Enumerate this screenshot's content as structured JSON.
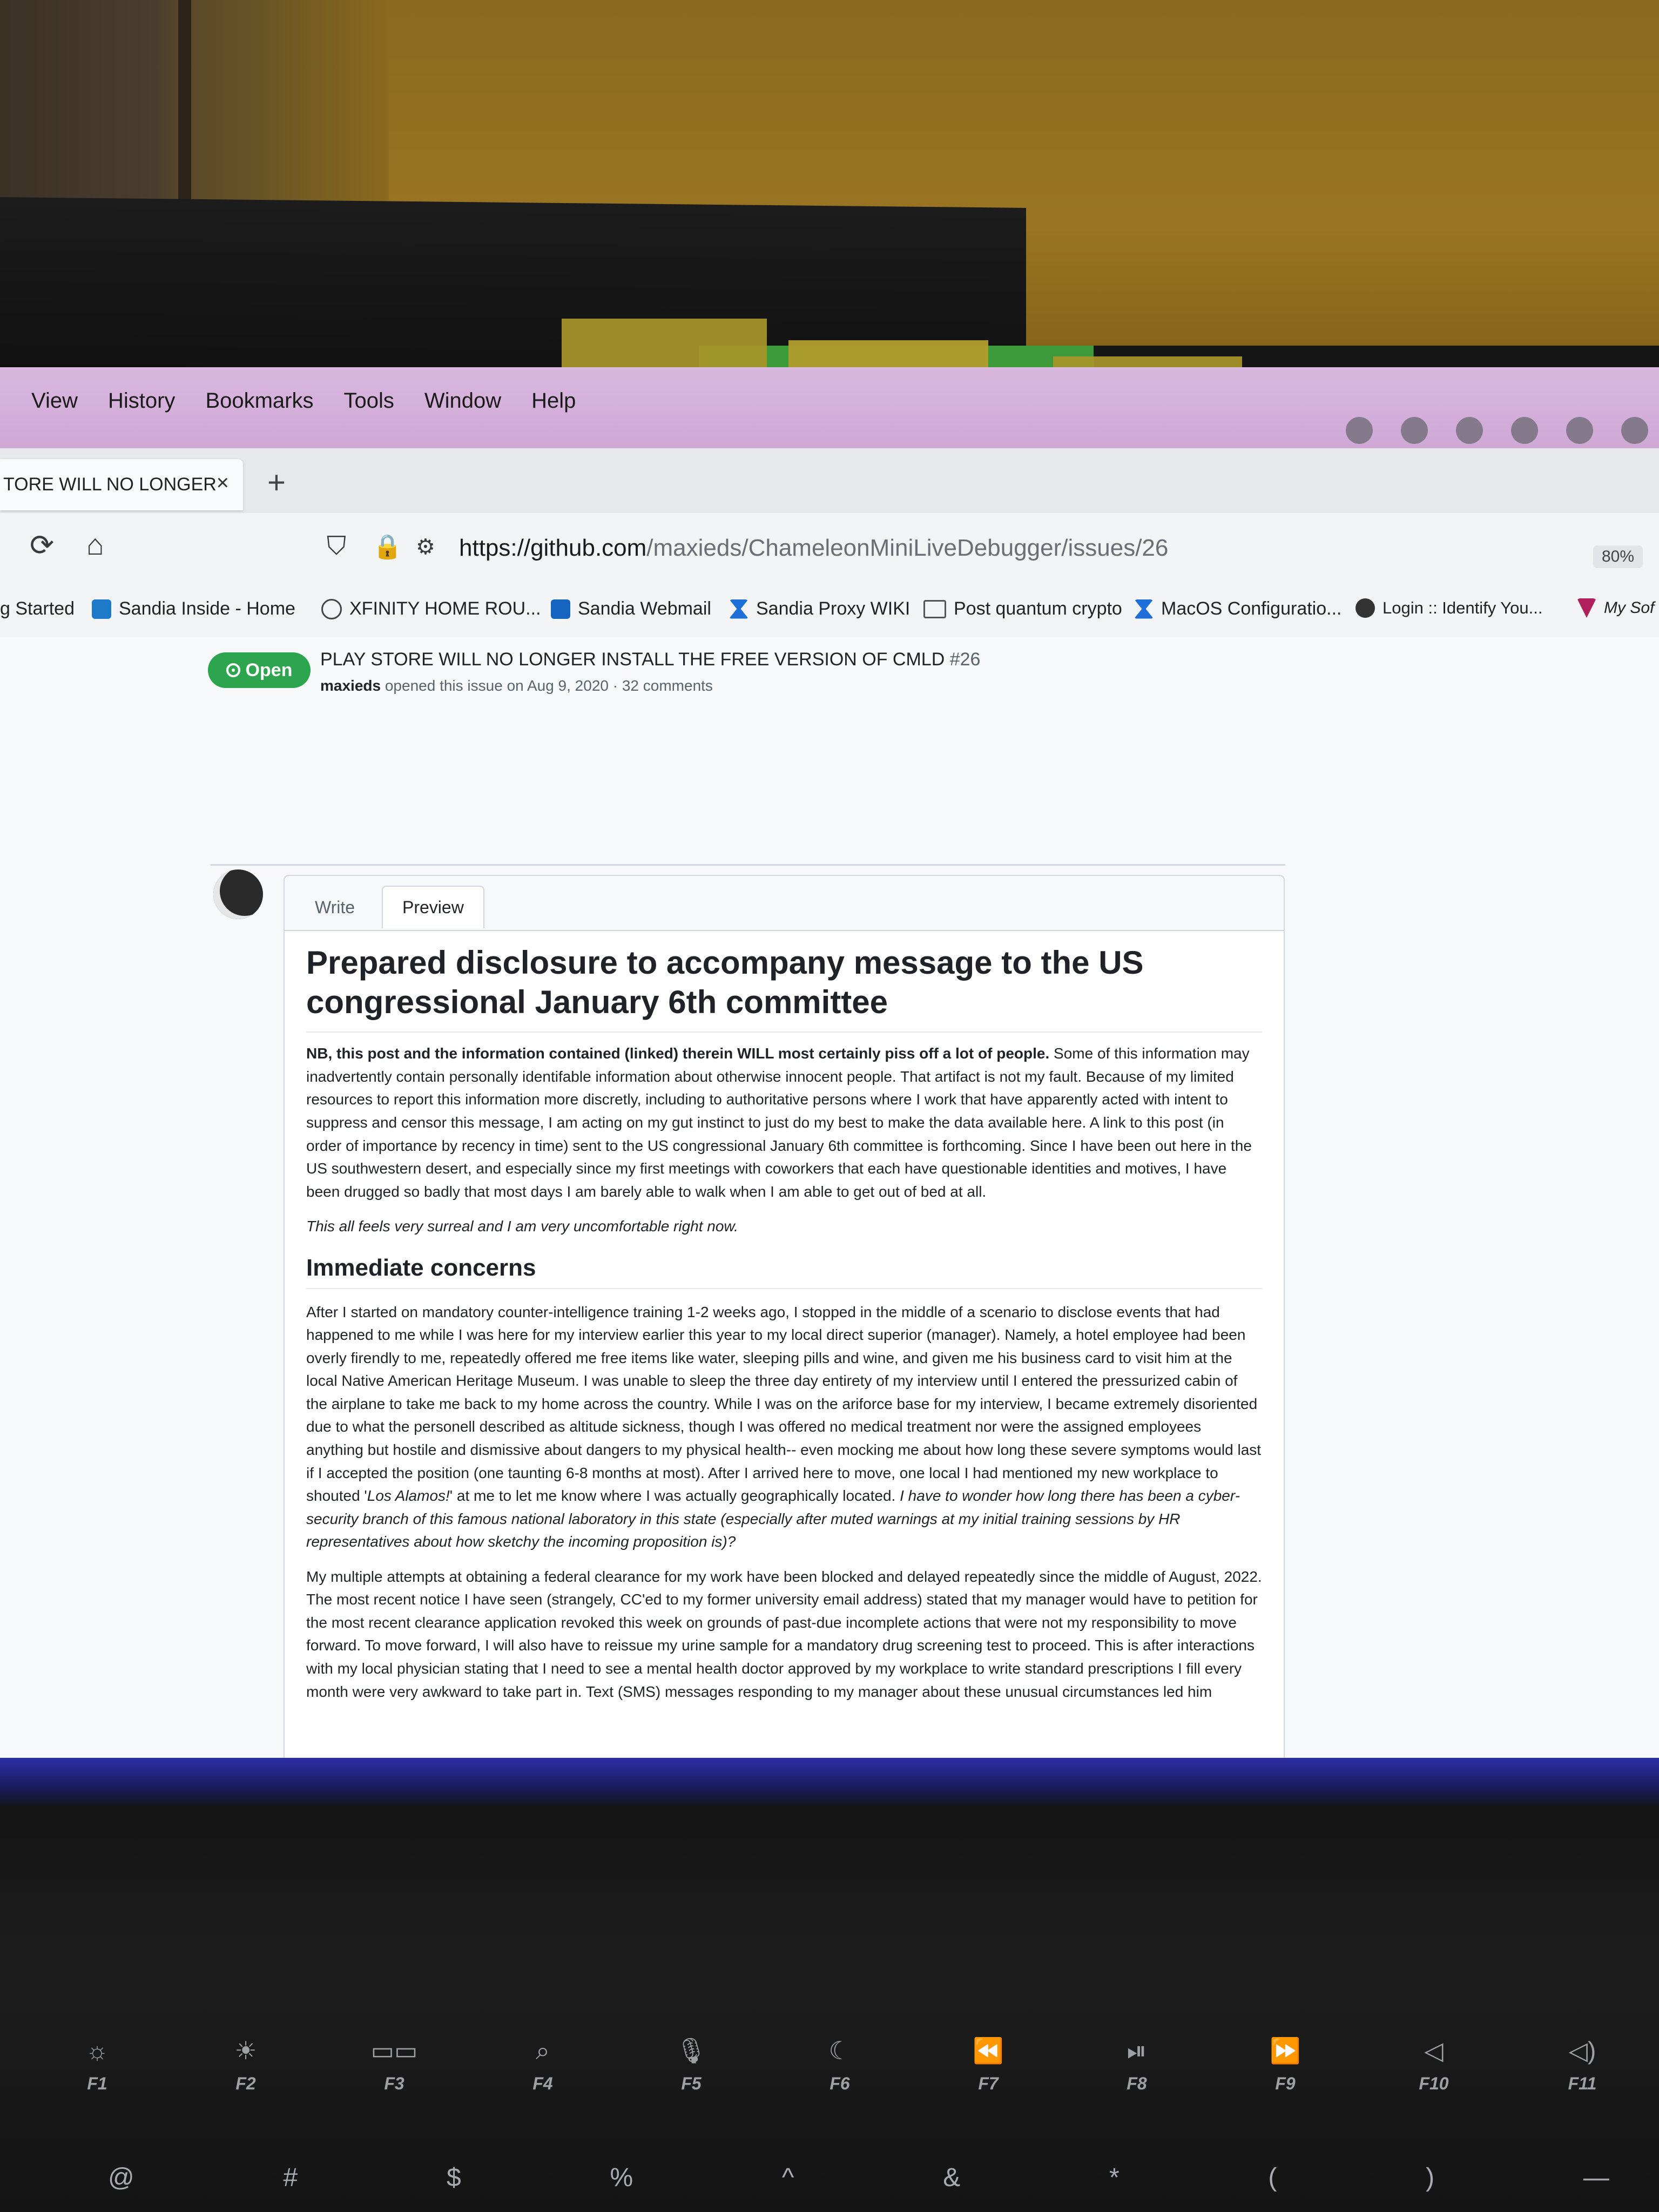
{
  "menubar": {
    "items": [
      "View",
      "History",
      "Bookmarks",
      "Tools",
      "Window",
      "Help"
    ]
  },
  "tab": {
    "title": "TORE WILL NO LONGER",
    "close": "×",
    "new_tab": "+"
  },
  "nav": {
    "url_host": "https://github.com",
    "url_path": "/maxieds/ChameleonMiniLiveDebugger/issues/26",
    "zoom": "80%"
  },
  "bookmarks": [
    {
      "label": "g Started"
    },
    {
      "label": "Sandia Inside - Home"
    },
    {
      "label": "XFINITY HOME ROU..."
    },
    {
      "label": "Sandia Webmail"
    },
    {
      "label": "Sandia Proxy WIKI"
    },
    {
      "label": "Post quantum crypto"
    },
    {
      "label": "MacOS Configuratio..."
    },
    {
      "label": "Login :: Identify You..."
    },
    {
      "label": "My Sof"
    }
  ],
  "issue": {
    "state": "Open",
    "title": "PLAY STORE WILL NO LONGER INSTALL THE FREE VERSION OF CMLD",
    "number": "#26",
    "author": "maxieds",
    "meta": "opened this issue on Aug 9, 2020 · 32 comments"
  },
  "editor": {
    "tab_write": "Write",
    "tab_preview": "Preview",
    "heading": "Prepared disclosure to accompany message to the US congressional January 6th committee",
    "p1_bold": "NB, this post and the information contained (linked) therein WILL most certainly piss off a lot of people.",
    "p1_rest": " Some of this information may inadvertently contain personally identifable information about otherwise innocent people. That artifact is not my fault. Because of my limited resources to report this information more discretly, including to authoritative persons where I work that have apparently acted with intent to suppress and censor this message, I am acting on my gut instinct to just do my best to make the data available here. A link to this post (in order of importance by recency in time) sent to the US congressional January 6th committee is forthcoming. Since I have been out here in the US southwestern desert, and especially since my first meetings with coworkers that each have questionable identities and motives, I have been drugged so badly that most days I am barely able to walk when I am able to get out of bed at all.",
    "p2": "This all feels very surreal and I am very uncomfortable right now.",
    "h2": "Immediate concerns",
    "p3_a": "After I started on mandatory counter-intelligence training 1-2 weeks ago, I stopped in the middle of a scenario to disclose events that had happened to me while I was here for my interview earlier this year to my local direct superior (manager). Namely, a hotel employee had been overly firendly to me, repeatedly offered me free items like water, sleeping pills and wine, and given me his business card to visit him at the local Native American Heritage Museum. I was unable to sleep the three day entirety of my interview until I entered the pressurized cabin of the airplane to take me back to my home across the country. While I was on the ariforce base for my interview, I became extremely disoriented due to what the personell described as altitude sickness, though I was offered no medical treatment nor were the assigned employees anything but hostile and dismissive about dangers to my physical health-- even mocking me about how long these severe symptoms would last if I accepted the position (one taunting 6-8 months at most). After I arrived here to move, one local I had mentioned my new workplace to shouted '",
    "p3_quote": "Los Alamos!",
    "p3_b": "' at me to let me know where I was actually geographically located. ",
    "p3_italic": "I have to wonder how long there has been a cyber-security branch of this famous national laboratory in this state (especially after muted warnings at my initial training sessions by HR representatives about how sketchy the incoming proposition is)?",
    "p4": "My multiple attempts at obtaining a federal clearance for my work have been blocked and delayed repeatedly since the middle of August, 2022. The most recent notice I have seen (strangely, CC'ed to my former university email address) stated that my manager would have to petition for the most recent clearance application revoked this week on grounds of past-due incomplete actions that were not my responsibility to move forward. To move forward, I will also have to reissue my urine sample for a mandatory drug screening test to proceed. This is after interactions with my local physician stating that I need to see a mental health doctor approved by my workplace to write standard prescriptions I fill every month were very awkward to take part in. Text (SMS) messages responding to my manager about these unusual circumstances led him"
  },
  "keyboard": {
    "fkeys": [
      {
        "icon": "brightness-down-icon",
        "glyph": "☼",
        "label": "F1"
      },
      {
        "icon": "brightness-up-icon",
        "glyph": "☀",
        "label": "F2"
      },
      {
        "icon": "mission-control-icon",
        "glyph": "▭▭",
        "label": "F3"
      },
      {
        "icon": "search-icon",
        "glyph": "⌕",
        "label": "F4"
      },
      {
        "icon": "microphone-icon",
        "glyph": "🎙",
        "label": "F5"
      },
      {
        "icon": "moon-icon",
        "glyph": "☾",
        "label": "F6"
      },
      {
        "icon": "rewind-icon",
        "glyph": "⏪",
        "label": "F7"
      },
      {
        "icon": "play-pause-icon",
        "glyph": "⏯",
        "label": "F8"
      },
      {
        "icon": "fast-forward-icon",
        "glyph": "⏩",
        "label": "F9"
      },
      {
        "icon": "mute-icon",
        "glyph": "◁",
        "label": "F10"
      },
      {
        "icon": "volume-down-icon",
        "glyph": "◁)",
        "label": "F11"
      }
    ],
    "symbols": [
      "@",
      "#",
      "$",
      "%",
      "^",
      "&",
      "*",
      "(",
      ")",
      "—"
    ]
  }
}
